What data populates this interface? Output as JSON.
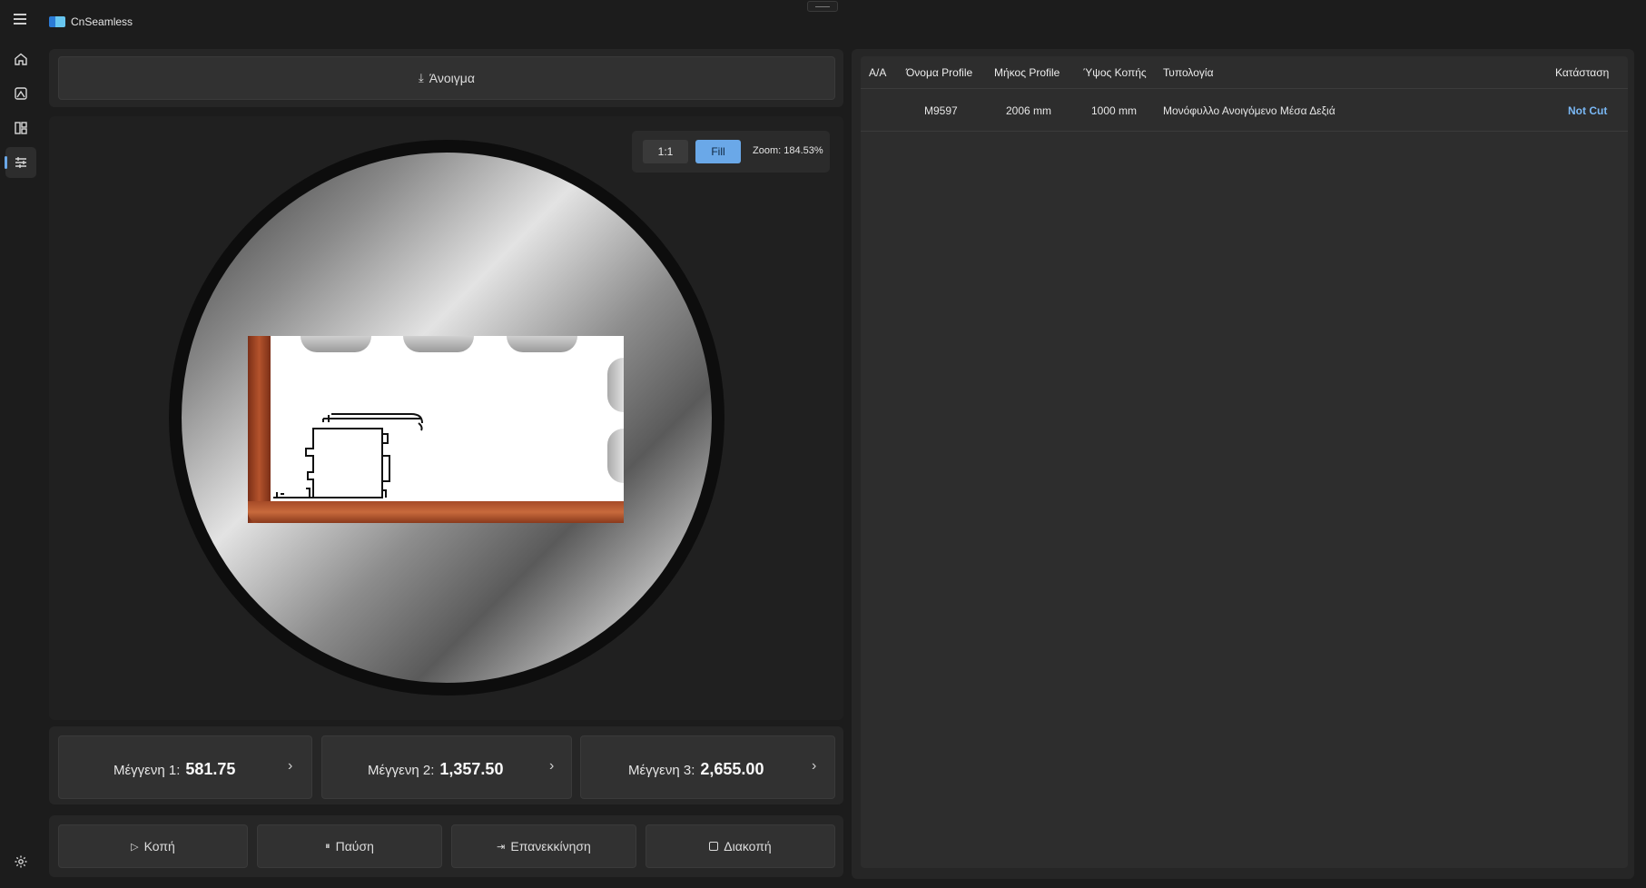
{
  "app": {
    "title": "CnSeamless"
  },
  "toolbar": {
    "open_label": "Άνοιγμα"
  },
  "zoom": {
    "actual_label": "1:1",
    "fill_label": "Fill",
    "zoom_text": "Zoom: 184.53%"
  },
  "vises": [
    {
      "label": "Μέγγενη 1:",
      "value": "581.75"
    },
    {
      "label": "Μέγγενη 2:",
      "value": "1,357.50"
    },
    {
      "label": "Μέγγενη 3:",
      "value": "2,655.00"
    }
  ],
  "actions": {
    "cut": "Κοπή",
    "pause": "Παύση",
    "restart": "Επανεκκίνηση",
    "stop": "Διακοπή"
  },
  "table": {
    "columns": [
      "Α/Α",
      "Όνομα Profile",
      "Μήκος Profile",
      "Ύψος Κοπής",
      "Τυπολογία",
      "Κατάσταση"
    ],
    "rows": [
      {
        "aa": "",
        "name": "M9597",
        "length": "2006 mm",
        "height": "1000 mm",
        "type": "Μονόφυλλο Ανοιγόμενο Μέσα Δεξιά",
        "status": "Not Cut"
      }
    ]
  },
  "colors": {
    "accent": "#6aa8e8",
    "status_not_cut": "#7ab8f5"
  }
}
